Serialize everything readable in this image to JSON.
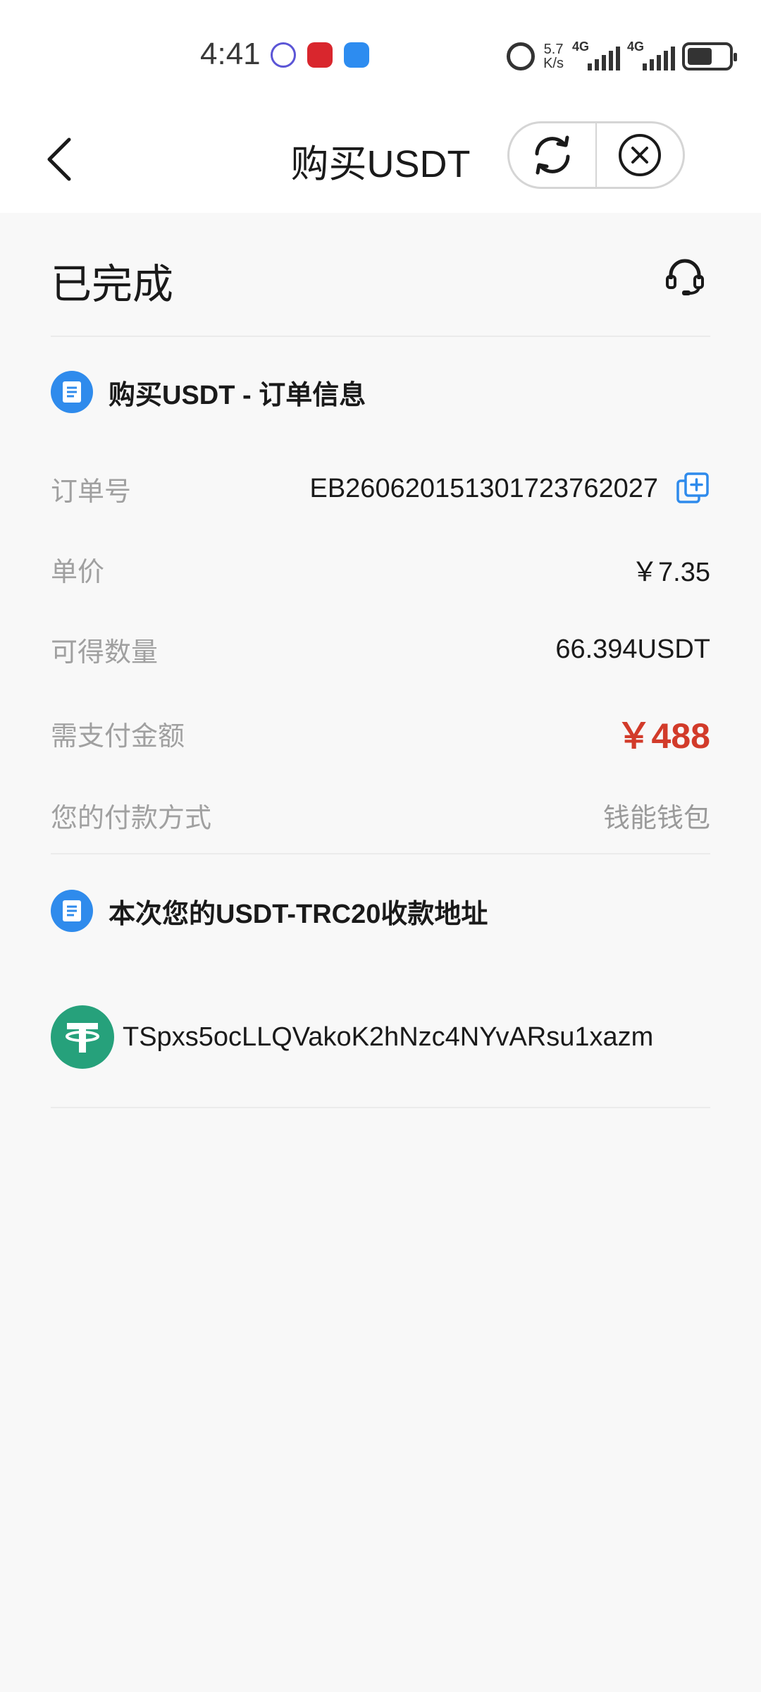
{
  "status_bar": {
    "time": "4:41",
    "net_speed_value": "5.7",
    "net_speed_unit": "K/s",
    "sim1_label": "4G",
    "sim2_label": "4G",
    "notification_icons": [
      "tieba-app-icon",
      "qutoutiao-app-icon",
      "weather-app-icon"
    ]
  },
  "header": {
    "title": "购买USDT",
    "back_icon": "chevron-left-icon",
    "refresh_icon": "refresh-icon",
    "close_icon": "close-circle-icon"
  },
  "order": {
    "status": "已完成",
    "support_icon": "headset-icon",
    "section_title": "购买USDT - 订单信息",
    "rows": [
      {
        "label": "订单号",
        "value": "EB2606201513017237620​27"
      },
      {
        "label": "单价",
        "value": "￥7.35"
      },
      {
        "label": "可得数量",
        "value": "66.394USDT"
      },
      {
        "label": "需支付金额",
        "value": "￥488"
      },
      {
        "label": "您的付款方式",
        "value": "钱能钱包"
      }
    ]
  },
  "address": {
    "section_title": "本次您的USDT-TRC20收款地址",
    "coin_icon": "tether-icon",
    "address": "TSpxs5ocLLQVakoK2hNzc4NYvARsu1xazm"
  },
  "colors": {
    "accent_blue": "#2f8bec",
    "amount_red": "#d23b2a",
    "tether_green": "#26a17b"
  }
}
